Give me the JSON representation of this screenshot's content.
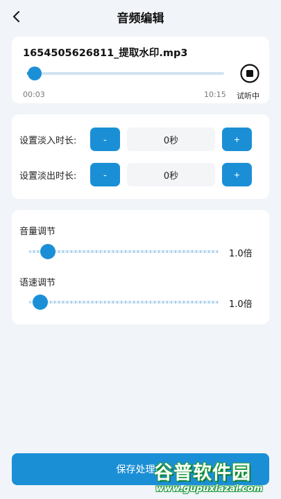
{
  "header": {
    "title": "音频编辑",
    "back_icon": "chevron-left-icon"
  },
  "audio": {
    "filename": "1654505626811_提取水印.mp3",
    "current_time": "00:03",
    "total_time": "10:15",
    "progress": 0.005,
    "stop_icon": "stop-circle-icon",
    "status": "试听中"
  },
  "fade": {
    "fade_in": {
      "label": "设置淡入时长:",
      "value": "0秒",
      "minus": "-",
      "plus": "+"
    },
    "fade_out": {
      "label": "设置淡出时长:",
      "value": "0秒",
      "minus": "-",
      "plus": "+"
    }
  },
  "adjust": {
    "volume": {
      "label": "音量调节",
      "value": "1.0倍",
      "level": 0.1
    },
    "speed": {
      "label": "语速调节",
      "value": "1.0倍",
      "level": 0.06
    }
  },
  "footer": {
    "save_label": "保存处理的",
    "watermark_text": "谷普软件园",
    "watermark_url": "www.gupuxiazai.com"
  },
  "colors": {
    "accent": "#1b8fd6",
    "background": "#f1f4f8",
    "card": "#ffffff"
  }
}
